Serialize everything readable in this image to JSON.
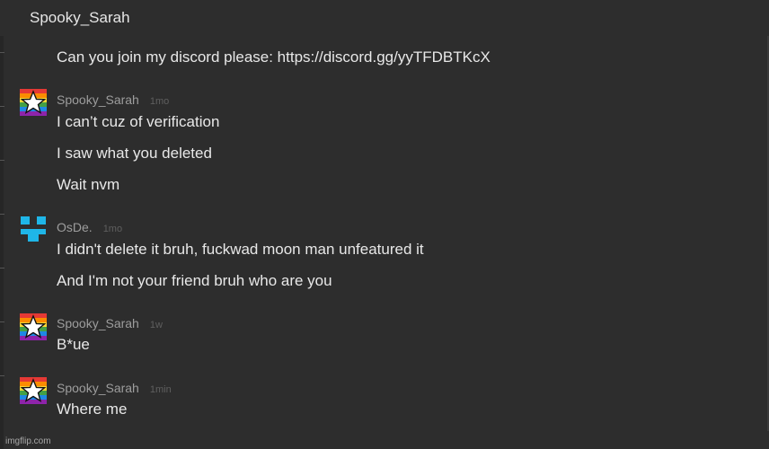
{
  "header": {
    "title": "Spooky_Sarah"
  },
  "truncated_message": "Can you join my discord please: https://discord.gg/yyTFDBTKcX",
  "messages": [
    {
      "author": "Spooky_Sarah",
      "time": "1mo",
      "avatar_icon": "rainbow-star-icon",
      "lines": [
        "I can’t cuz of verification",
        "I saw what you deleted",
        "Wait nvm"
      ]
    },
    {
      "author": "OsDe.",
      "time": "1mo",
      "avatar_icon": "blue-face-icon",
      "lines": [
        "I didn't delete it bruh, fuckwad moon man unfeatured it",
        "And I'm not your friend bruh who are you"
      ]
    },
    {
      "author": "Spooky_Sarah",
      "time": "1w",
      "avatar_icon": "rainbow-star-icon",
      "lines": [
        "B*ue"
      ]
    },
    {
      "author": "Spooky_Sarah",
      "time": "1min",
      "avatar_icon": "rainbow-star-icon",
      "lines": [
        "Where me"
      ]
    }
  ],
  "watermark": "imgflip.com",
  "colors": {
    "background": "#2d2d2d",
    "text": "#e8e8e8",
    "author": "#9d9d9d",
    "timestamp": "#5f5f5f",
    "osde_avatar": "#1fb6e8"
  }
}
